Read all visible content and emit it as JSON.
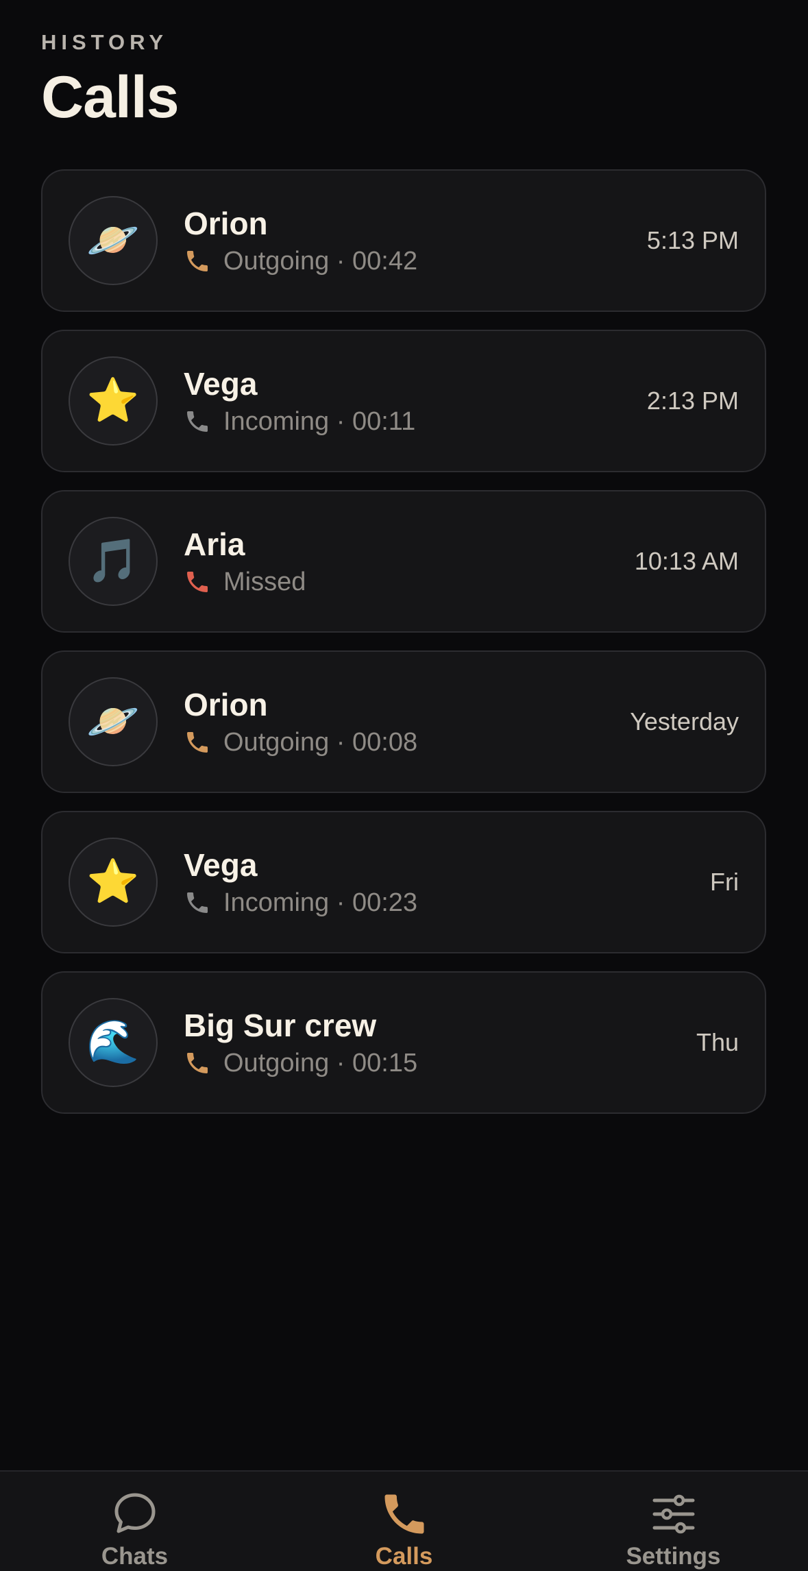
{
  "header": {
    "eyebrow": "HISTORY",
    "title": "Calls"
  },
  "colors": {
    "background": "#0a0a0c",
    "card": "#151517",
    "accent": "#d49a5d",
    "incoming": "#8a8a8a",
    "missed": "#e0604f"
  },
  "calls": [
    {
      "avatar": "🪐",
      "avatar_icon": "planet-icon",
      "name": "Orion",
      "type": "outgoing",
      "detail": "Outgoing · 00:42",
      "time": "5:13 PM"
    },
    {
      "avatar": "⭐",
      "avatar_icon": "star-icon",
      "name": "Vega",
      "type": "incoming",
      "detail": "Incoming · 00:11",
      "time": "2:13 PM"
    },
    {
      "avatar": "🎵",
      "avatar_icon": "music-note-icon",
      "name": "Aria",
      "type": "missed",
      "detail": "Missed",
      "time": "10:13 AM"
    },
    {
      "avatar": "🪐",
      "avatar_icon": "planet-icon",
      "name": "Orion",
      "type": "outgoing",
      "detail": "Outgoing · 00:08",
      "time": "Yesterday"
    },
    {
      "avatar": "⭐",
      "avatar_icon": "star-icon",
      "name": "Vega",
      "type": "incoming",
      "detail": "Incoming · 00:23",
      "time": "Fri"
    },
    {
      "avatar": "🌊",
      "avatar_icon": "wave-icon",
      "name": "Big Sur crew",
      "type": "outgoing",
      "detail": "Outgoing · 00:15",
      "time": "Thu"
    }
  ],
  "tabs": [
    {
      "label": "Chats",
      "icon": "chat-bubble-icon",
      "active": false
    },
    {
      "label": "Calls",
      "icon": "phone-icon",
      "active": true
    },
    {
      "label": "Settings",
      "icon": "sliders-icon",
      "active": false
    }
  ]
}
